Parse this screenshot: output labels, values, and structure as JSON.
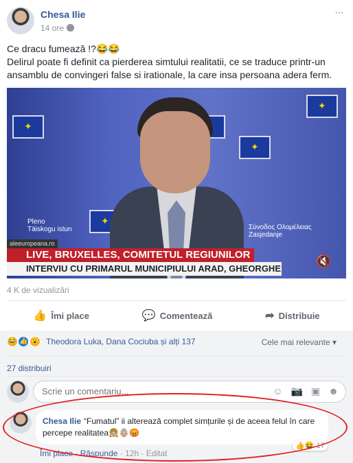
{
  "post": {
    "author": "Chesa Ilie",
    "time": "14 ore",
    "more": "···",
    "line1": "Ce dracu fumează !?😂😂",
    "line2": "Delirul poate fi definit ca pierderea simtului realitatii, ce se traduce printr-un ansamblu de convingeri false si irationale, la care insa persoana adera ferm."
  },
  "video": {
    "side_left": "Pleno\nTäiskogu istun",
    "side_right": "Σύνοδος Ολομέλειας\nZasjedanje",
    "site": "aleeuropeana.ro",
    "banner1": "LIVE, BRUXELLES, COMITETUL REGIUNILOR",
    "banner2": "INTERVIU CU PRIMARUL MUNICIPIULUI ARAD, GHEORGHE FALCA"
  },
  "views": "4 K de vizualizări",
  "actions": {
    "like": "Îmi place",
    "comment": "Comentează",
    "share": "Distribuie"
  },
  "reactions": {
    "names": "Theodora Luka, Dana Cociuba și alți 137",
    "sort": "Cele mai relevante ▾"
  },
  "shares": "27 distribuiri",
  "write": {
    "placeholder": "Scrie un comentariu..."
  },
  "comment": {
    "author": "Chesa Ilie",
    "text": "“Fumatul” ii alterează complet simțurile și de aceea felul în care percepe realitatea👧🏼👵🏼😡",
    "react_count": "17",
    "like": "Îmi place",
    "reply": "Răspunde",
    "time": "12h",
    "edited": "Editat"
  },
  "colors": {
    "link": "#385898",
    "highlight_ring": "#e0201c"
  }
}
